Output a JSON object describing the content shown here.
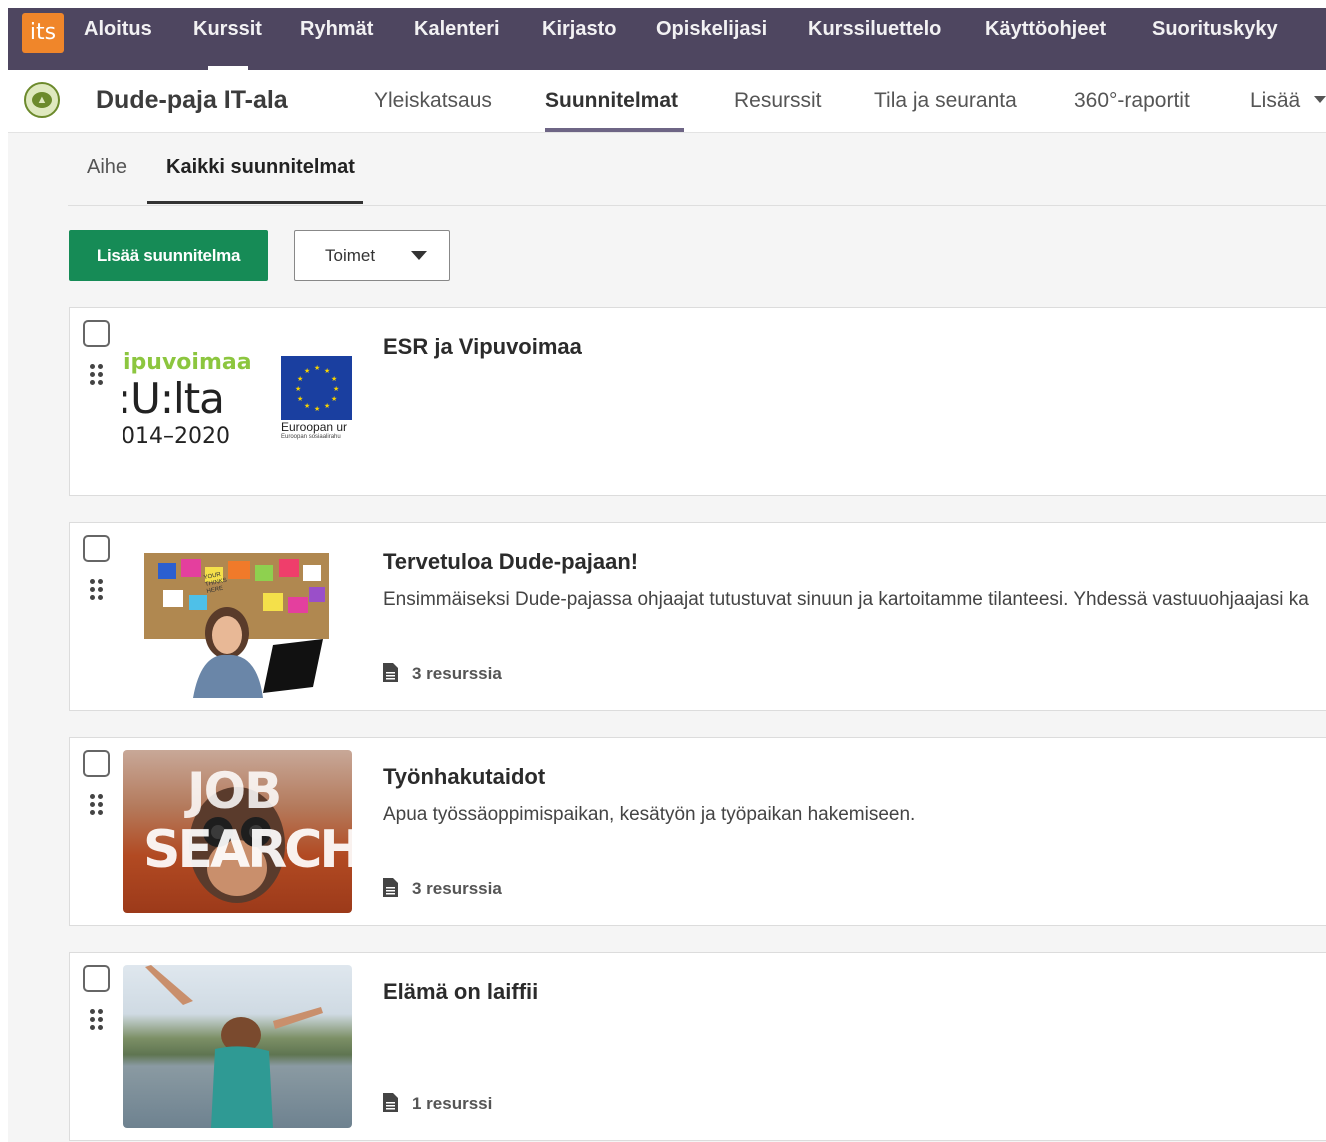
{
  "topnav": {
    "logo": "its",
    "items": [
      "Aloitus",
      "Kurssit",
      "Ryhmät",
      "Kalenteri",
      "Kirjasto",
      "Opiskelijasi",
      "Kurssiluettelo",
      "Käyttöohjeet",
      "Suorituskyky"
    ],
    "active": "Kurssit"
  },
  "course": {
    "title": "Dude-paja IT-ala",
    "tabs": [
      "Yleiskatsaus",
      "Suunnitelmat",
      "Resurssit",
      "Tila ja seuranta",
      "360°-raportit",
      "Lisää"
    ],
    "active_tab": "Suunnitelmat"
  },
  "subtabs": [
    "Aihe",
    "Kaikki suunnitelmat"
  ],
  "active_subtab": "Kaikki suunnitelmat",
  "toolbar": {
    "add_label": "Lisää suunnitelma",
    "actions_label": "Toimet"
  },
  "plans": [
    {
      "title": "ESR ja Vipuvoimaa",
      "description": "",
      "resources": "",
      "thumb_text": {
        "line1": "ipuvoimaa",
        "line2": ":U:lta",
        "line3": "014–2020",
        "eu_caption": "Euroopan ur",
        "eu_caption_small": "Euroopan sosiaalirahu"
      }
    },
    {
      "title": "Tervetuloa Dude-pajaan!",
      "description": "Ensimmäiseksi Dude-pajassa ohjaajat tutustuvat sinuun ja kartoitamme tilanteesi. Yhdessä vastuuohjaajasi ka",
      "resources": "3 resurssia",
      "thumb_text": {
        "note": "YOUR THINKS HERE"
      }
    },
    {
      "title": "Työnhakutaidot",
      "description": "Apua työssäoppimispaikan, kesätyön ja työpaikan hakemiseen.",
      "resources": "3 resurssia",
      "thumb_text": {
        "line1": "JOB",
        "line2": "SEARCH"
      }
    },
    {
      "title": "Elämä on laiffii",
      "description": "",
      "resources": "1 resurssi",
      "thumb_text": {}
    }
  ],
  "colors": {
    "topnav_bg": "#4e4660",
    "logo_bg": "#f0862a",
    "add_button": "#168b56",
    "content_bg": "#f5f5f5"
  }
}
